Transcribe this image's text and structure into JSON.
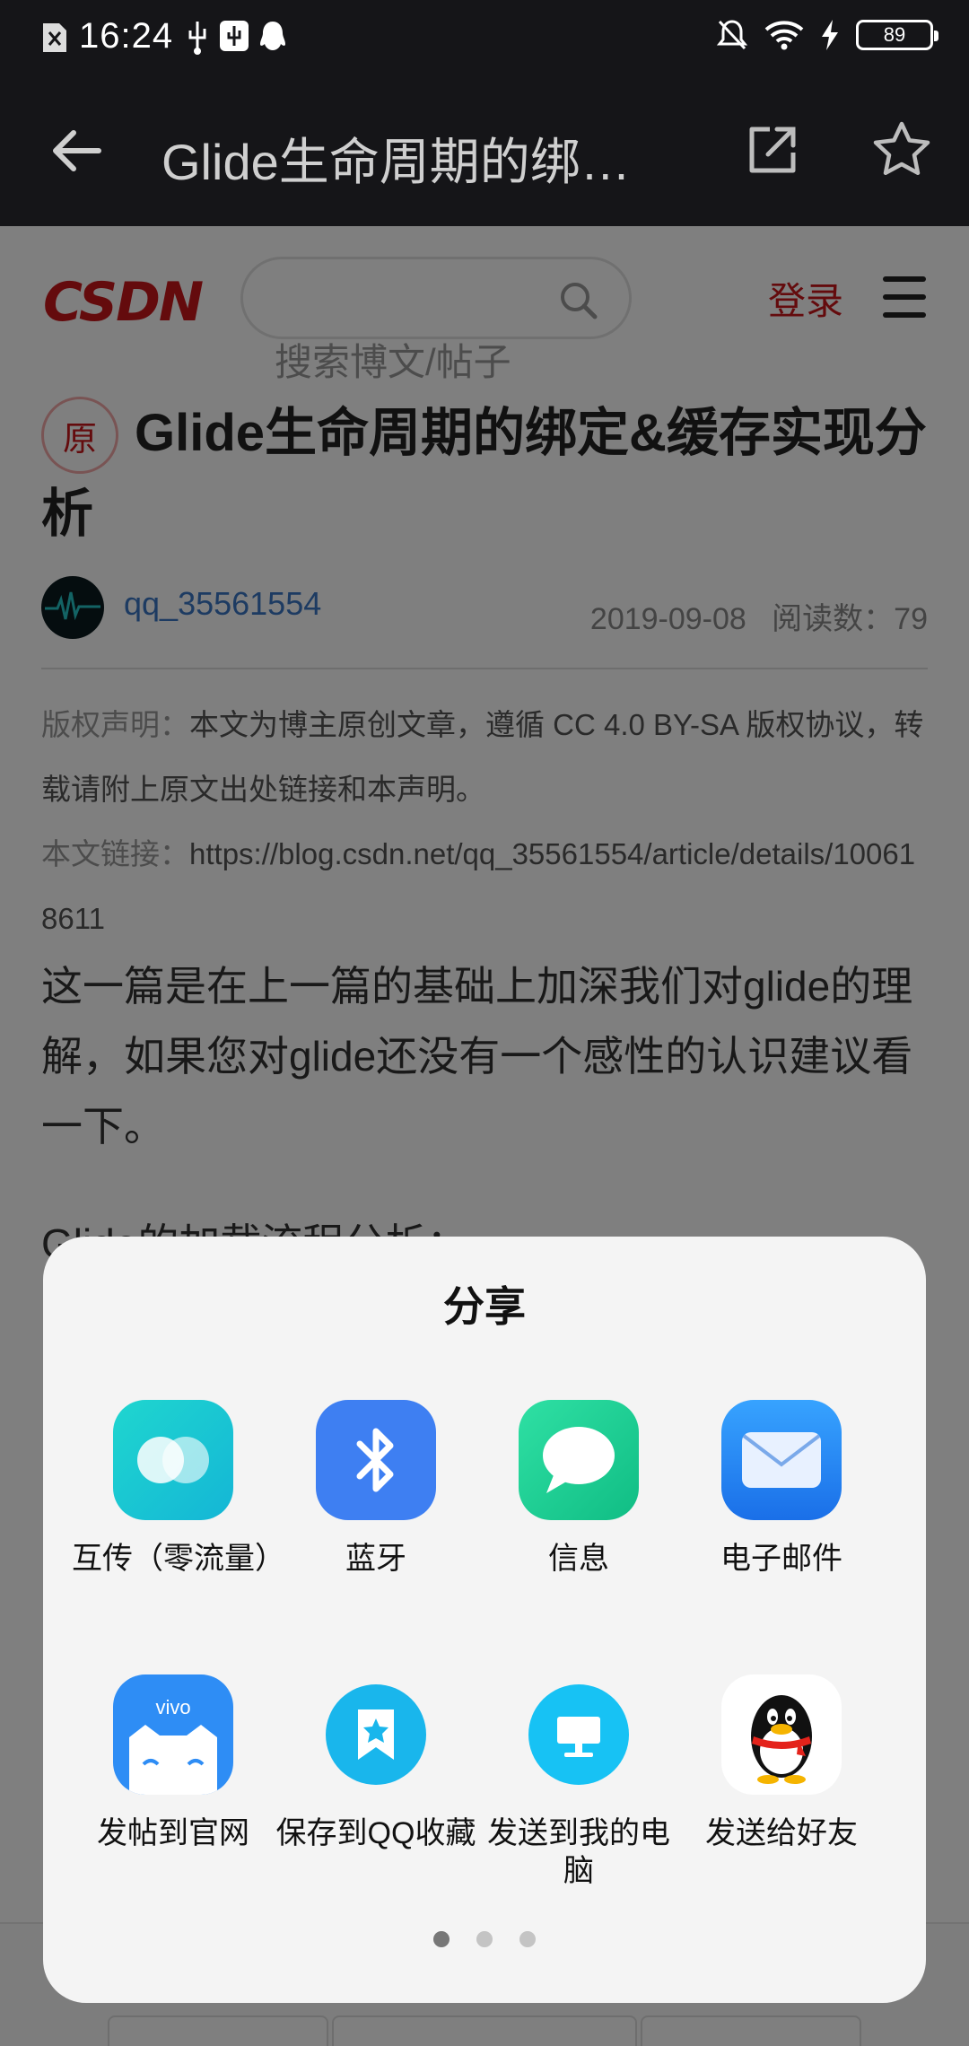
{
  "status_bar": {
    "time": "16:24",
    "battery": "89"
  },
  "app_bar": {
    "title": "Glide生命周期的绑…"
  },
  "csdn": {
    "logo": "CSDN",
    "search_placeholder": "搜索博文/帖子",
    "login": "登录"
  },
  "article": {
    "badge": "原",
    "title": "Glide生命周期的绑定&缓存实现分析",
    "author": "qq_35561554",
    "date": "2019-09-08",
    "reads_label": "阅读数：",
    "reads": "79",
    "copyright_label": "版权声明：",
    "copyright_text": "本文为博主原创文章，遵循 CC 4.0 BY-SA 版权协议，转载请附上原文出处链接和本声明。",
    "link_label": "本文链接：",
    "link_url": "https://blog.csdn.net/qq_35561554/article/details/100618611",
    "body": "这一篇是在上一篇的基础上加深我们对glide的理解，如果您对glide还没有一个感性的认识建议看一下。",
    "sub_heading": "Glide的加载流程分析："
  },
  "share_sheet": {
    "title": "分享",
    "items": [
      {
        "label": "互传（零流量）",
        "icon": "transfer-icon",
        "color": "#17c7d0"
      },
      {
        "label": "蓝牙",
        "icon": "bluetooth-icon",
        "color": "#3e7ff2"
      },
      {
        "label": "信息",
        "icon": "message-icon",
        "color": "#1ccf94"
      },
      {
        "label": "电子邮件",
        "icon": "mail-icon",
        "color": "#2e88f0"
      },
      {
        "label": "发帖到官网",
        "icon": "vivo-forum-icon",
        "color": "#2e8df5"
      },
      {
        "label": "保存到QQ收藏",
        "icon": "qq-favorites-icon",
        "color": "#19b6ec"
      },
      {
        "label": "发送到我的电脑",
        "icon": "my-computer-icon",
        "color": "#17c2f4"
      },
      {
        "label": "发送给好友",
        "icon": "qq-penguin-icon",
        "color": "#ffffff"
      }
    ],
    "pages": 3,
    "current_page": 1
  }
}
